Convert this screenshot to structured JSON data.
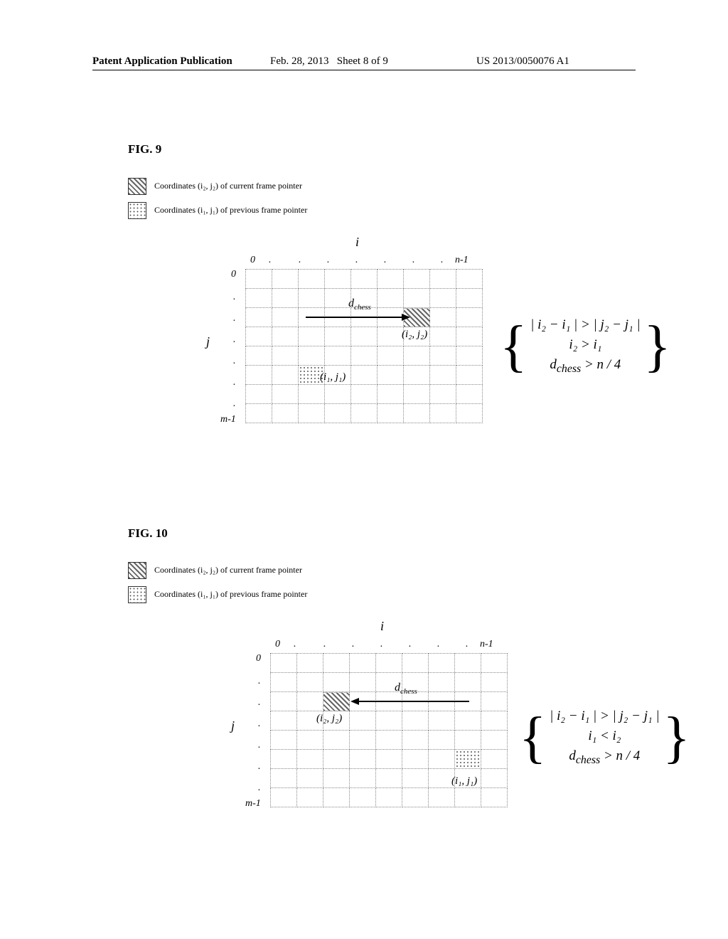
{
  "header": {
    "left": "Patent Application Publication",
    "mid_date": "Feb. 28, 2013",
    "mid_sheet": "Sheet 8 of 9",
    "right": "US 2013/0050076 A1"
  },
  "fig9": {
    "label": "FIG. 9",
    "legend_current": "Coordinates (i₂, j₂) of current frame pointer",
    "legend_previous": "Coordinates (i₁, j₁) of previous frame pointer",
    "axis_i": "i",
    "axis_j": "j",
    "tick_0_row": "0",
    "tick_end_row": "m-1",
    "tick_0_col": "0",
    "tick_end_col": "n-1",
    "d_label": "d",
    "d_sub": "chess",
    "coord_curr": "(i₂, j₂)",
    "coord_prev": "(i₁, j₁)",
    "cond1": "| i₂ − i₁ | > | j₂ − j₁ |",
    "cond2": "i₂ > i₁",
    "cond3_lhs": "d",
    "cond3_sub": "chess",
    "cond3_rhs": " > n / 4"
  },
  "fig10": {
    "label": "FIG. 10",
    "legend_current": "Coordinates (i₂, j₂) of current frame pointer",
    "legend_previous": "Coordinates (i₁, j₁) of previous frame pointer",
    "axis_i": "i",
    "axis_j": "j",
    "tick_0_row": "0",
    "tick_end_row": "m-1",
    "tick_0_col": "0",
    "tick_end_col": "n-1",
    "d_label": "d",
    "d_sub": "chess",
    "coord_curr": "(i₂, j₂)",
    "coord_prev": "(i₁, j₁)",
    "cond1": "| i₂ − i₁ | > | j₂ − j₁ |",
    "cond2": "i₁ < i₂",
    "cond3_lhs": "d",
    "cond3_sub": "chess",
    "cond3_rhs": " > n / 4"
  },
  "chart_data": [
    {
      "type": "table",
      "figure": 9,
      "grid": {
        "rows": 8,
        "cols": 9,
        "row_index": "j",
        "col_index": "i"
      },
      "points": [
        {
          "name": "current",
          "coord": "(i2,j2)",
          "row": 2,
          "col": 6,
          "pattern": "hatch"
        },
        {
          "name": "previous",
          "coord": "(i1,j1)",
          "row": 5,
          "col": 2,
          "pattern": "dot"
        }
      ],
      "arrow": {
        "direction": "right",
        "row": 2,
        "from_col": 2,
        "to_col": 6,
        "label": "d_chess"
      },
      "conditions": [
        "|i2 - i1| > |j2 - j1|",
        "i2 > i1",
        "d_chess > n/4"
      ]
    },
    {
      "type": "table",
      "figure": 10,
      "grid": {
        "rows": 8,
        "cols": 9,
        "row_index": "j",
        "col_index": "i"
      },
      "points": [
        {
          "name": "current",
          "coord": "(i2,j2)",
          "row": 2,
          "col": 2,
          "pattern": "hatch"
        },
        {
          "name": "previous",
          "coord": "(i1,j1)",
          "row": 5,
          "col": 7,
          "pattern": "dot"
        }
      ],
      "arrow": {
        "direction": "left",
        "row": 2,
        "from_col": 7,
        "to_col": 2,
        "label": "d_chess"
      },
      "conditions": [
        "|i2 - i1| > |j2 - j1|",
        "i1 < i2",
        "d_chess > n/4"
      ]
    }
  ]
}
